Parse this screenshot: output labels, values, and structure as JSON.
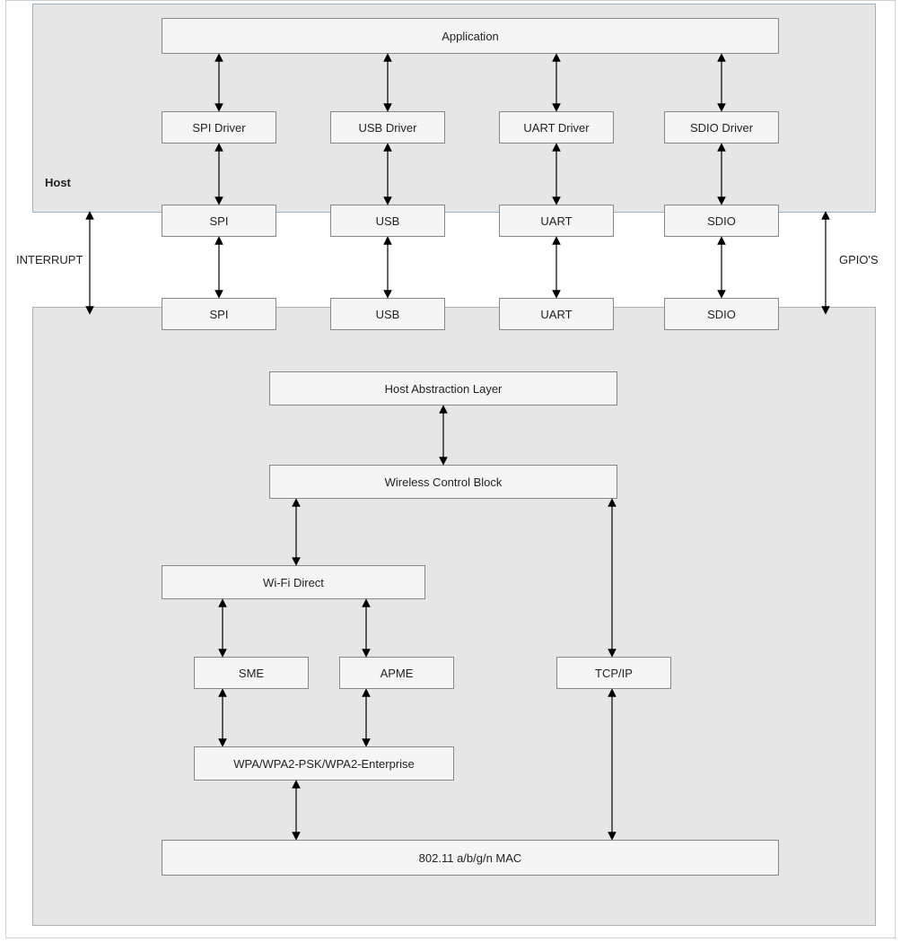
{
  "labels": {
    "host": "Host",
    "interrupt": "INTERRUPT",
    "gpios": "GPIO'S"
  },
  "blocks": {
    "application": "Application",
    "spi_driver": "SPI Driver",
    "usb_driver": "USB Driver",
    "uart_driver": "UART Driver",
    "sdio_driver": "SDIO Driver",
    "spi_host": "SPI",
    "usb_host": "USB",
    "uart_host": "UART",
    "sdio_host": "SDIO",
    "spi_mod": "SPI",
    "usb_mod": "USB",
    "uart_mod": "UART",
    "sdio_mod": "SDIO",
    "hal": "Host Abstraction Layer",
    "wcb": "Wireless Control Block",
    "wifi_direct": "Wi-Fi Direct",
    "sme": "SME",
    "apme": "APME",
    "tcpip": "TCP/IP",
    "wpa": "WPA/WPA2-PSK/WPA2-Enterprise",
    "mac": "802.11 a/b/g/n MAC"
  }
}
